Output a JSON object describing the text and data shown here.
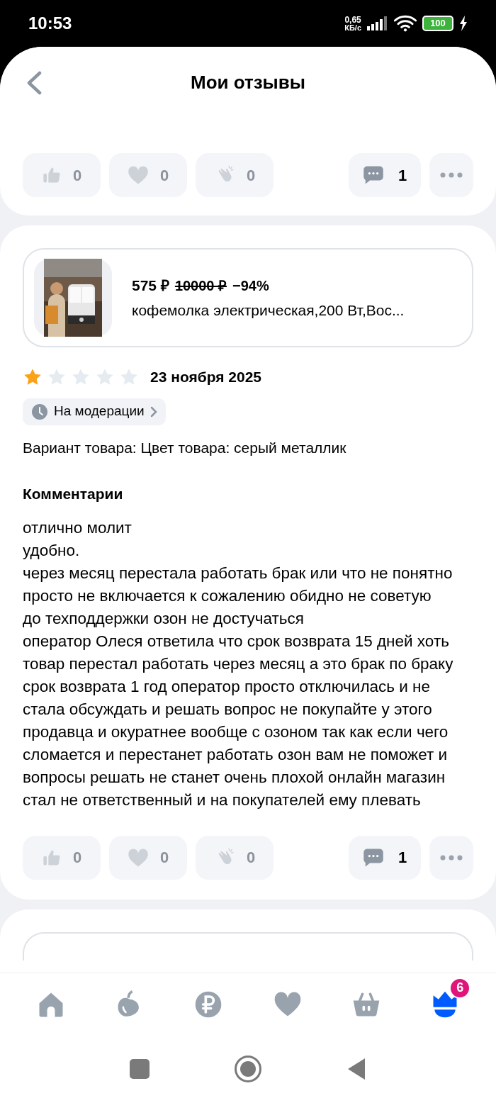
{
  "status_bar": {
    "time": "10:53",
    "speed_value": "0,65",
    "speed_unit": "КБ/с",
    "battery": "100"
  },
  "header": {
    "title": "Мои отзывы"
  },
  "previous_review": {
    "reactions": [
      {
        "kind": "like",
        "count": "0"
      },
      {
        "kind": "heart",
        "count": "0"
      },
      {
        "kind": "clap",
        "count": "0"
      }
    ],
    "comments": "1"
  },
  "review": {
    "product": {
      "price": "575 ₽",
      "old_price": "10000 ₽",
      "discount": "−94%",
      "name": "кофемолка электрическая,200 Вт,Вос..."
    },
    "stars": 1,
    "date": "23 ноября 2025",
    "status": "На модерации",
    "variant": "Вариант товара: Цвет товара: серый металлик",
    "comments_heading": "Комментарии",
    "comment": "отлично молит\nудобно.\nчерез месяц перестала работать брак или что не понятно просто не включается к сожалению обидно не советую\nдо техподдержки озон не достучаться\nоператор Олеся ответила что срок возврата 15 дней хоть товар перестал работать через месяц а это брак по браку срок возврата 1 год оператор просто отключилась и не стала обсуждать и решать вопрос не покупайте у этого продавца и окуратнее вообще с озоном так как если чего сломается и перестанет работать озон вам не поможет и вопросы решать не станет очень плохой онлайн магазин стал не ответственный и на покупателей ему плевать",
    "reactions": [
      {
        "kind": "like",
        "count": "0"
      },
      {
        "kind": "heart",
        "count": "0"
      },
      {
        "kind": "clap",
        "count": "0"
      }
    ],
    "comments": "1"
  },
  "bottom_nav": [
    {
      "kind": "home",
      "selected": false
    },
    {
      "kind": "fresh",
      "selected": false
    },
    {
      "kind": "finance",
      "selected": false
    },
    {
      "kind": "favorites",
      "selected": false
    },
    {
      "kind": "cart",
      "selected": false
    },
    {
      "kind": "profile",
      "selected": true,
      "badge": "6"
    }
  ]
}
